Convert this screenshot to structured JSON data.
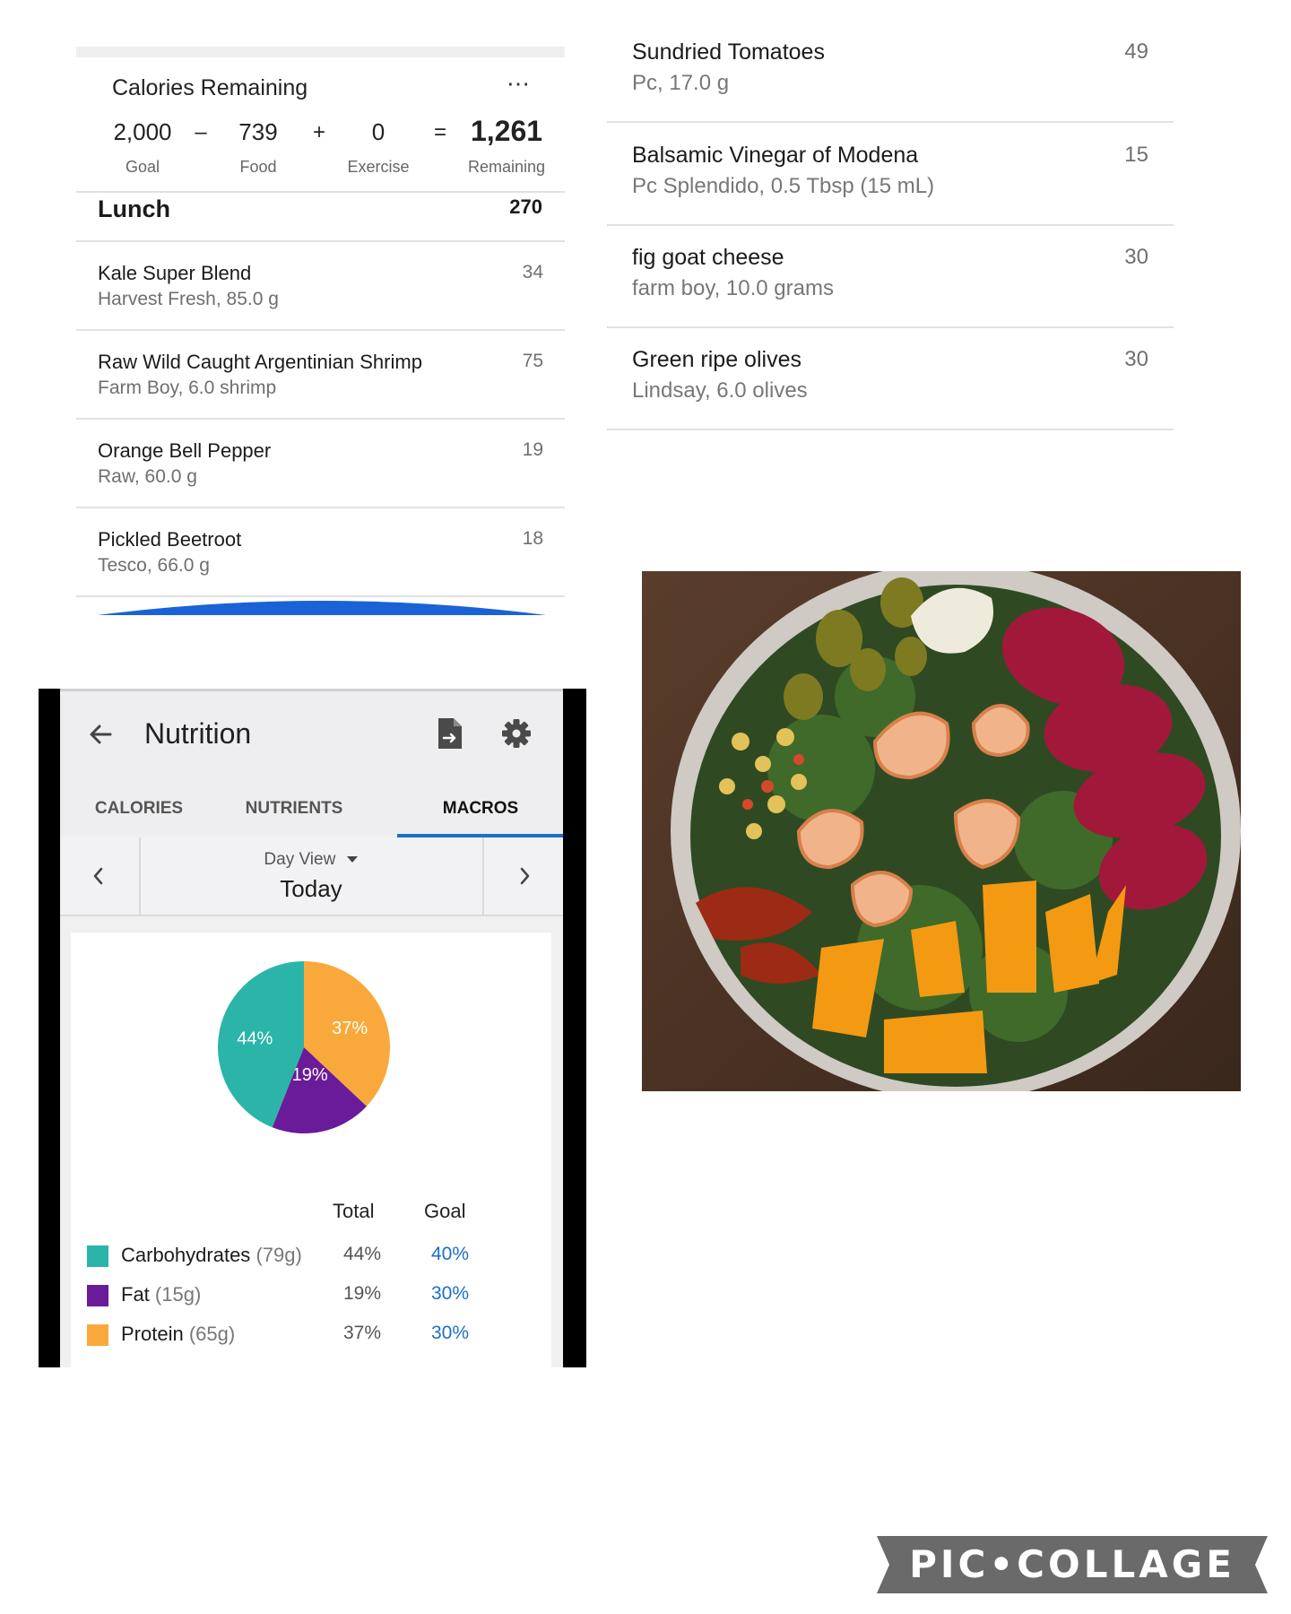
{
  "calories": {
    "title": "Calories Remaining",
    "more_icon": "⋯",
    "goal_value": "2,000",
    "goal_label": "Goal",
    "minus": "–",
    "food_value": "739",
    "food_label": "Food",
    "plus": "+",
    "exercise_value": "0",
    "exercise_label": "Exercise",
    "equals": "=",
    "remaining_value": "1,261",
    "remaining_label": "Remaining"
  },
  "lunch": {
    "title": "Lunch",
    "total": "270",
    "items": [
      {
        "name": "Kale Super Blend",
        "sub": "Harvest Fresh, 85.0 g",
        "cal": "34"
      },
      {
        "name": "Raw Wild Caught Argentinian Shrimp",
        "sub": "Farm Boy, 6.0 shrimp",
        "cal": "75"
      },
      {
        "name": "Orange Bell Pepper",
        "sub": "Raw, 60.0 g",
        "cal": "19"
      },
      {
        "name": "Pickled Beetroot",
        "sub": "Tesco, 66.0 g",
        "cal": "18"
      }
    ]
  },
  "more_items": [
    {
      "name": "Sundried Tomatoes",
      "sub": "Pc, 17.0 g",
      "cal": "49"
    },
    {
      "name": "Balsamic Vinegar of Modena",
      "sub": "Pc Splendido, 0.5 Tbsp (15 mL)",
      "cal": "15"
    },
    {
      "name": "fig goat cheese",
      "sub": "farm boy, 10.0 grams",
      "cal": "30"
    },
    {
      "name": "Green ripe olives",
      "sub": "Lindsay, 6.0 olives",
      "cal": "30"
    }
  ],
  "nutrition": {
    "title": "Nutrition",
    "icons": {
      "back": "arrow-left-icon",
      "report": "file-export-icon",
      "settings": "gear-icon"
    },
    "tabs": [
      "CALORIES",
      "NUTRIENTS",
      "MACROS"
    ],
    "active_tab": "MACROS",
    "day_view_label": "Day View",
    "date": "Today",
    "table_headers": {
      "total": "Total",
      "goal": "Goal"
    },
    "macros": [
      {
        "name": "Carbohydrates",
        "grams": "(79g)",
        "total": "44%",
        "goal": "40%",
        "color": "#2bb5a8"
      },
      {
        "name": "Fat",
        "grams": "(15g)",
        "total": "19%",
        "goal": "30%",
        "color": "#6a1b9a"
      },
      {
        "name": "Protein",
        "grams": "(65g)",
        "total": "37%",
        "goal": "30%",
        "color": "#f9a93b"
      }
    ],
    "accent_color": "#1d6fc8"
  },
  "chart_data": {
    "type": "pie",
    "categories": [
      "Carbohydrates",
      "Fat",
      "Protein"
    ],
    "values": [
      44,
      19,
      37
    ],
    "labels": [
      "44%",
      "19%",
      "37%"
    ],
    "colors": [
      "#2bb5a8",
      "#6a1b9a",
      "#f9a93b"
    ]
  },
  "watermark": "PIC•COLLAGE"
}
